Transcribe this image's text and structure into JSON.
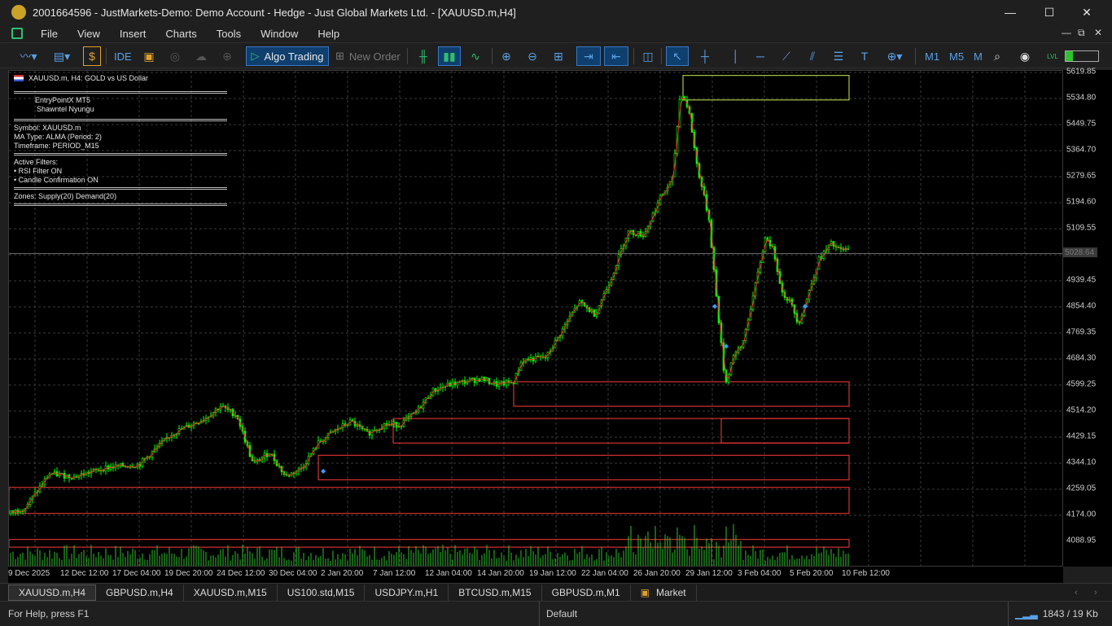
{
  "window": {
    "title": "2001664596 - JustMarkets-Demo: Demo Account - Hedge - Just Global Markets Ltd. - [XAUUSD.m,H4]",
    "minimize": "—",
    "maximize": "☐",
    "close": "✕"
  },
  "menu": [
    "File",
    "View",
    "Insert",
    "Charts",
    "Tools",
    "Window",
    "Help"
  ],
  "mdi_controls": [
    "—",
    "⧉",
    "✕"
  ],
  "toolbar": {
    "ide_label": "IDE",
    "algo_trading_label": "Algo Trading",
    "new_order_label": "New Order",
    "tf_m1": "M1",
    "tf_m5": "M5",
    "tf_more": "M",
    "lvl": "LVL"
  },
  "chart": {
    "header": "XAUUSD.m, H4:  GOLD vs US Dollar",
    "panel": {
      "name": "EntryPointX MT5",
      "author": "Shawntel Nyungu",
      "symbol": "Symbol: XAUUSD.m",
      "ma_type": "MA Type: ALMA (Period: 2)",
      "timeframe": "Timeframe: PERIOD_M15",
      "filters_title": "Active Filters:",
      "filter_rsi": "• RSI Filter ON",
      "filter_candle": "• Candle Confirmation ON",
      "zones": "Zones: Supply(20) Demand(20)"
    },
    "current_price_label": "5028.64",
    "current_price": 5028.64,
    "y_ticks": [
      "5619.85",
      "5534.80",
      "5449.75",
      "5364.70",
      "5279.65",
      "5194.60",
      "5109.55",
      "4939.45",
      "4854.40",
      "4769.35",
      "4684.30",
      "4599.25",
      "4514.20",
      "4429.15",
      "4344.10",
      "4259.05",
      "4174.00",
      "4088.95"
    ],
    "x_ticks": [
      "9 Dec 2025",
      "12 Dec 12:00",
      "17 Dec 04:00",
      "19 Dec 20:00",
      "24 Dec 12:00",
      "30 Dec 04:00",
      "2 Jan 20:00",
      "7 Jan 12:00",
      "12 Jan 04:00",
      "14 Jan 20:00",
      "19 Jan 12:00",
      "22 Jan 04:00",
      "26 Jan 20:00",
      "29 Jan 12:00",
      "3 Feb 04:00",
      "5 Feb 20:00",
      "10 Feb 12:00"
    ],
    "colors": {
      "bull": "#00ff00",
      "bear": "#00ff00",
      "ma": "#ff2a2a",
      "zone_demand": "#ff3b3b",
      "zone_supply": "#c8f050",
      "grid": "#3a3a3a",
      "volume": "#2fbf2f"
    }
  },
  "tabs": [
    "XAUUSD.m,H4",
    "GBPUSD.m,H4",
    "XAUUSD.m,M15",
    "US100.std,M15",
    "USDJPY.m,H1",
    "BTCUSD.m,M15",
    "GBPUSD.m,M1",
    "Market"
  ],
  "status": {
    "help": "For Help, press F1",
    "profile": "Default",
    "traffic": "1843 / 19 Kb"
  }
}
